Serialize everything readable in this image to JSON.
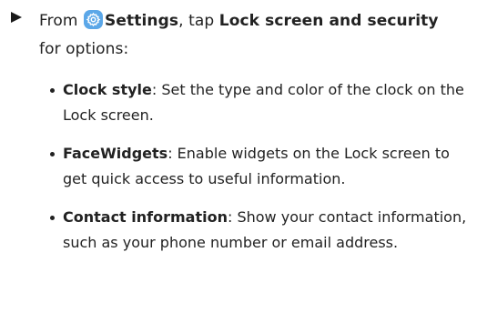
{
  "step": {
    "prefix": "From",
    "icon": "settings-gear-icon",
    "icon_color": "#5ba7e8",
    "settings_label": "Settings",
    "middle": ", tap ",
    "target_label": "Lock screen and security",
    "suffix": "for options:"
  },
  "bullets": [
    {
      "term": "Clock style",
      "description": ": Set the type and color of the clock on the Lock screen."
    },
    {
      "term": "FaceWidgets",
      "description": ": Enable widgets on the Lock screen to get quick access to useful information."
    },
    {
      "term": "Contact information",
      "description": ": Show your contact information, such as your phone number or email address."
    }
  ]
}
